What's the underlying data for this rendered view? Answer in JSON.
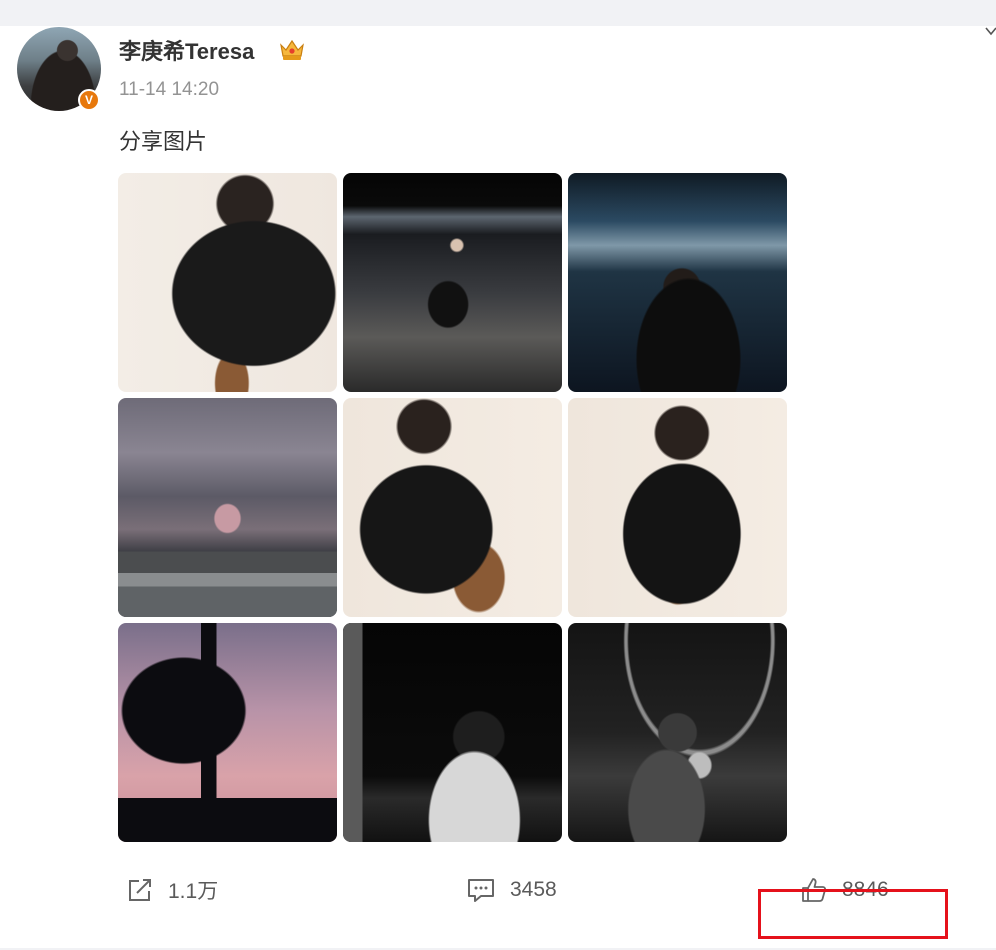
{
  "post": {
    "username": "李庚希Teresa",
    "timestamp": "11-14 14:20",
    "text": "分享图片",
    "avatar_badge": "V"
  },
  "images": [
    {
      "name": "photo-1"
    },
    {
      "name": "photo-2"
    },
    {
      "name": "photo-3"
    },
    {
      "name": "photo-4"
    },
    {
      "name": "photo-5"
    },
    {
      "name": "photo-6"
    },
    {
      "name": "photo-7"
    },
    {
      "name": "photo-8"
    },
    {
      "name": "photo-9"
    }
  ],
  "actions": {
    "share_count": "1.1万",
    "comment_count": "3458",
    "like_count": "8846"
  },
  "icons": {
    "share": "share-icon",
    "comment": "comment-icon",
    "like": "thumbs-up-icon",
    "more": "chevron-down-icon",
    "vip": "crown-icon"
  },
  "colors": {
    "highlight": "#e5111b",
    "badge": "#e7780c"
  }
}
